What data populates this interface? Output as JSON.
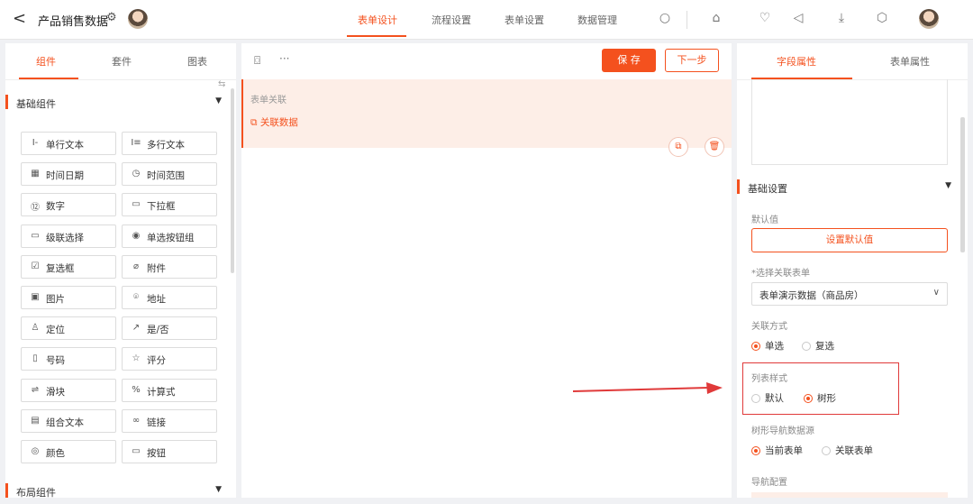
{
  "header": {
    "back_glyph": "<",
    "title": "产品销售数据",
    "tabs": [
      {
        "label": "表单设计",
        "active": true
      },
      {
        "label": "流程设置",
        "active": false
      },
      {
        "label": "表单设置",
        "active": false
      },
      {
        "label": "数据管理",
        "active": false
      }
    ]
  },
  "left_panel": {
    "tabs": [
      "组件",
      "套件",
      "图表"
    ],
    "section_basic": "基础组件",
    "section_layout": "布局组件",
    "components": [
      {
        "label": "单行文本",
        "icon": "I-"
      },
      {
        "label": "多行文本",
        "icon": "I≡"
      },
      {
        "label": "时间日期",
        "icon": "▦"
      },
      {
        "label": "时间范围",
        "icon": "◷"
      },
      {
        "label": "数字",
        "icon": "⑫"
      },
      {
        "label": "下拉框",
        "icon": "▭"
      },
      {
        "label": "级联选择",
        "icon": "▭"
      },
      {
        "label": "单选按钮组",
        "icon": "◉"
      },
      {
        "label": "复选框",
        "icon": "☑"
      },
      {
        "label": "附件",
        "icon": "⌀"
      },
      {
        "label": "图片",
        "icon": "▣"
      },
      {
        "label": "地址",
        "icon": "⌾"
      },
      {
        "label": "定位",
        "icon": "♙"
      },
      {
        "label": "是/否",
        "icon": "↗"
      },
      {
        "label": "号码",
        "icon": "▯"
      },
      {
        "label": "评分",
        "icon": "☆"
      },
      {
        "label": "滑块",
        "icon": "⇌"
      },
      {
        "label": "计算式",
        "icon": "%"
      },
      {
        "label": "组合文本",
        "icon": "▤"
      },
      {
        "label": "链接",
        "icon": "∞"
      },
      {
        "label": "颜色",
        "icon": "◎"
      },
      {
        "label": "按钮",
        "icon": "▭"
      }
    ]
  },
  "canvas": {
    "dots": "···",
    "save_label": "保 存",
    "next_label": "下一步",
    "field_label": "表单关联",
    "field_value": "关联数据"
  },
  "right_panel": {
    "tabs": [
      "字段属性",
      "表单属性"
    ],
    "section_basic": "基础设置",
    "default_value_label": "默认值",
    "set_default_button": "设置默认值",
    "select_form_label": "*选择关联表单",
    "select_form_value": "表单演示数据（商品房）",
    "relation_mode_label": "关联方式",
    "relation_mode_options": [
      {
        "label": "单选",
        "selected": true
      },
      {
        "label": "复选",
        "selected": false
      }
    ],
    "list_style_label": "列表样式",
    "list_style_options": [
      {
        "label": "默认",
        "selected": false
      },
      {
        "label": "树形",
        "selected": true
      }
    ],
    "tree_source_label": "树形导航数据源",
    "tree_source_options": [
      {
        "label": "当前表单",
        "selected": true
      },
      {
        "label": "关联表单",
        "selected": false
      }
    ],
    "nav_config_label": "导航配置"
  },
  "colors": {
    "accent": "#f4511e",
    "highlight_box": "#e03a3a"
  }
}
